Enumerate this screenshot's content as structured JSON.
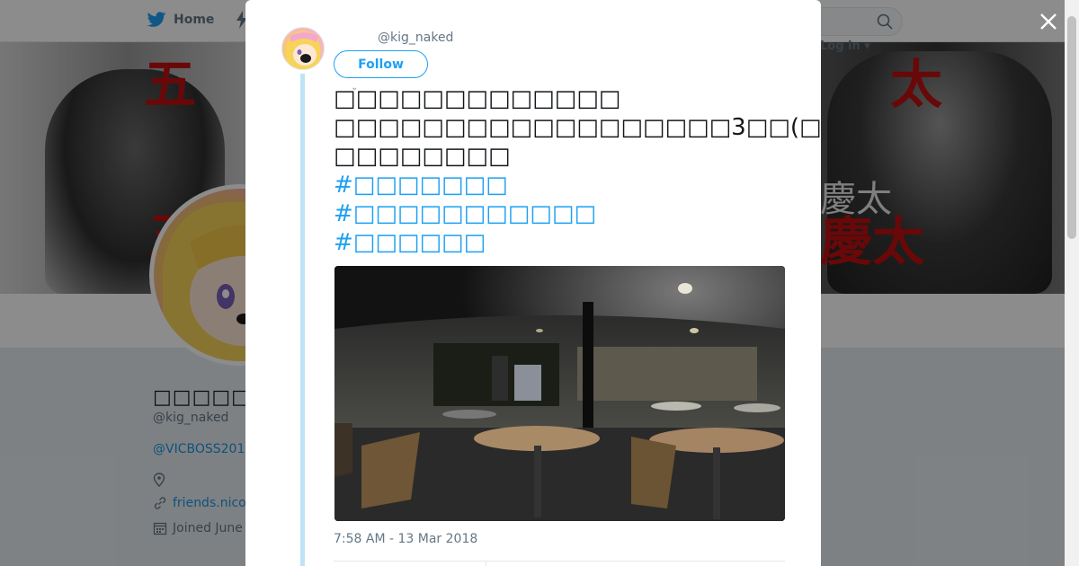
{
  "nav": {
    "home_label": "Home",
    "login_label": "Log in"
  },
  "banner": {
    "kanji_left_top": "五",
    "kanji_left_mid": "五",
    "kanji_right_top": "太",
    "kanji_right_mid": "慶太",
    "kanji_right_gray": "慶太"
  },
  "profile": {
    "name": "□□□□□",
    "handle": "@kig_naked",
    "mention_link": "@VICBOSS201",
    "website": "friends.nico",
    "joined": "Joined June"
  },
  "tweet": {
    "handle": "@kig_naked",
    "follow_label": "Follow",
    "lines": [
      "□□□□□□□□□□□□□",
      "□□□□□□□□□□□□□□□□□□3□□(□□□□□)",
      "□□□□□□□□"
    ],
    "hashtags": [
      "#□□□□□□□",
      "#□□□□□□□□□□□",
      "#□□□□□□"
    ],
    "timestamp": "7:58 AM - 13 Mar 2018"
  },
  "colors": {
    "accent": "#1da1f2",
    "banner_red": "#c01010",
    "thread_line": "#bfe3f5"
  },
  "icons": {
    "close": "close-icon",
    "search": "search-icon",
    "home": "bird-icon"
  }
}
